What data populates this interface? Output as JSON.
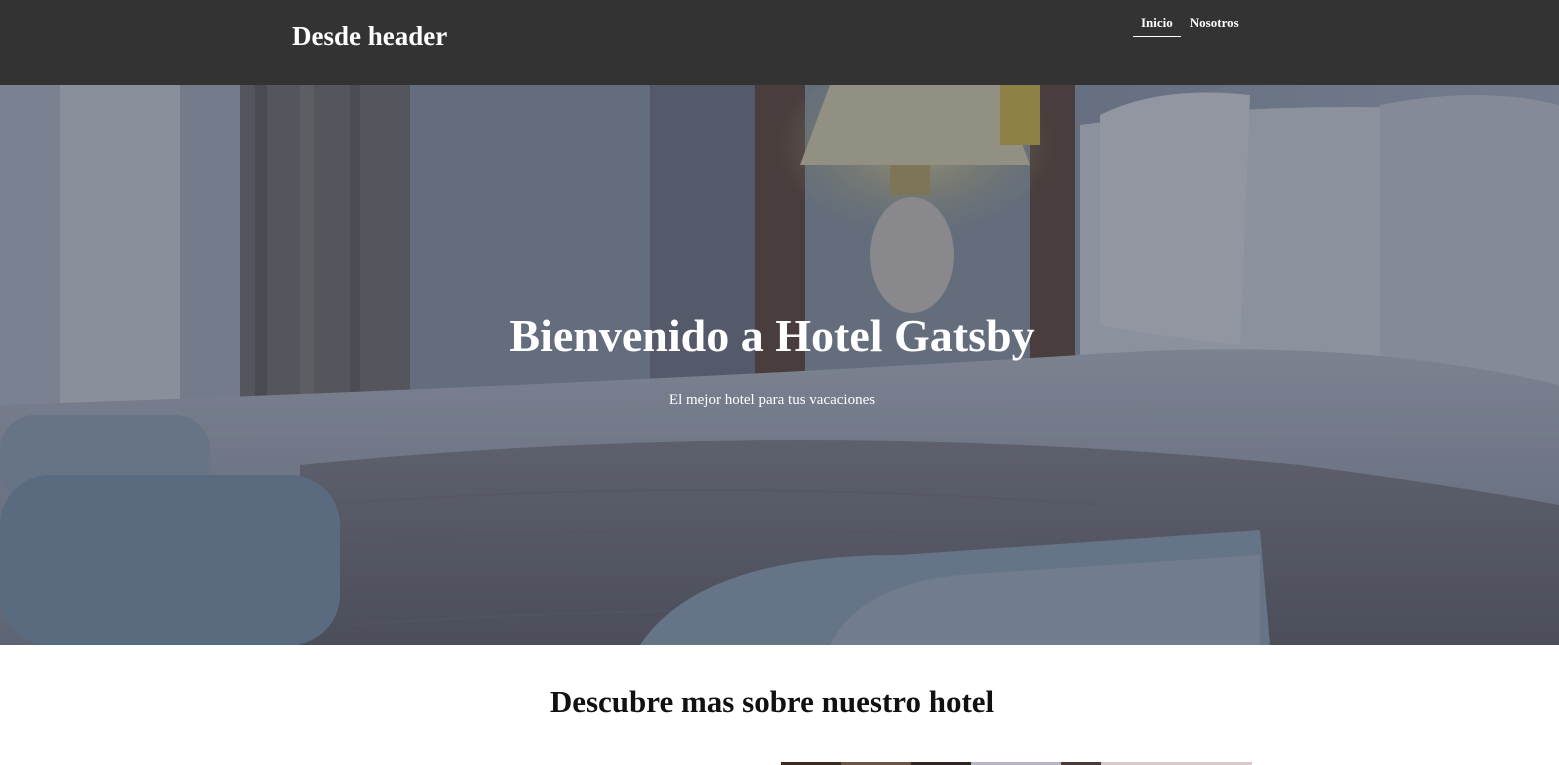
{
  "header": {
    "site_title": "Desde header",
    "nav": [
      {
        "label": "Inicio",
        "active": true
      },
      {
        "label": "Nosotros",
        "active": false
      }
    ]
  },
  "hero": {
    "title": "Bienvenido a Hotel Gatsby",
    "subtitle": "El mejor hotel para tus vacaciones"
  },
  "about": {
    "heading": "Descubre mas sobre nuestro hotel"
  },
  "colors": {
    "header_bg": "#333333",
    "text_light": "#ffffff",
    "text_dark": "#111111",
    "page_bg": "#ffffff"
  }
}
